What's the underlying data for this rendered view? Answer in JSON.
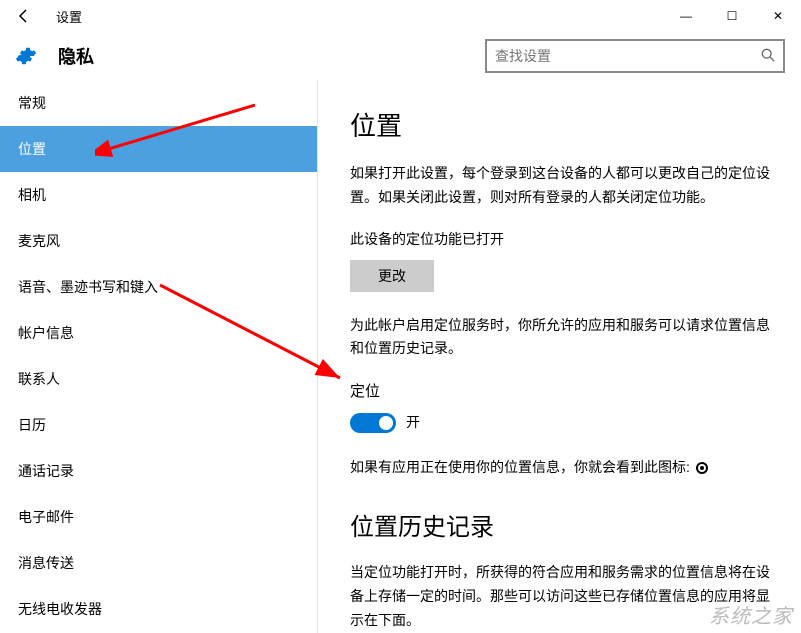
{
  "window": {
    "title": "设置",
    "controls": {
      "min": "—",
      "max": "☐",
      "close": "✕"
    }
  },
  "header": {
    "page_title": "隐私",
    "search_placeholder": "查找设置"
  },
  "sidebar": {
    "items": [
      {
        "label": "常规"
      },
      {
        "label": "位置"
      },
      {
        "label": "相机"
      },
      {
        "label": "麦克风"
      },
      {
        "label": "语音、墨迹书写和键入"
      },
      {
        "label": "帐户信息"
      },
      {
        "label": "联系人"
      },
      {
        "label": "日历"
      },
      {
        "label": "通话记录"
      },
      {
        "label": "电子邮件"
      },
      {
        "label": "消息传送"
      },
      {
        "label": "无线电收发器"
      }
    ],
    "selected_index": 1
  },
  "main": {
    "heading": "位置",
    "description": "如果打开此设置，每个登录到这台设备的人都可以更改自己的定位设置。如果关闭此设置，则对所有登录的人都关闭定位功能。",
    "device_status": "此设备的定位功能已打开",
    "change_button": "更改",
    "service_para": "为此帐户启用定位服务时，你所允许的应用和服务可以请求位置信息和位置历史记录。",
    "locate_label": "定位",
    "toggle_state": "开",
    "icon_hint": "如果有应用正在使用你的位置信息，你就会看到此图标:",
    "history_heading": "位置历史记录",
    "history_para": "当定位功能打开时，所获得的符合应用和服务需求的位置信息将在设备上存储一定的时间。那些可以访问这些已存储位置信息的应用将显示在下面。"
  },
  "watermark": "系统之家"
}
